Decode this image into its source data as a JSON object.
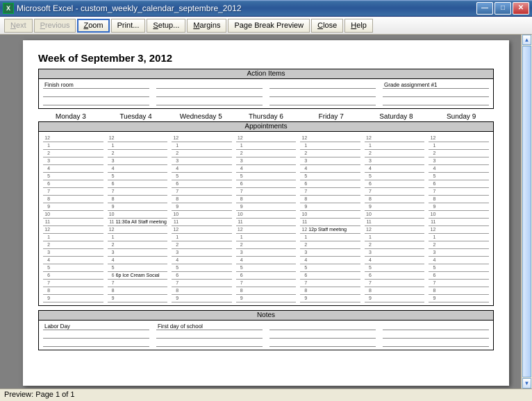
{
  "window": {
    "app_name": "Microsoft Excel",
    "doc_name": "custom_weekly_calendar_septembre_2012",
    "title_sep": " - "
  },
  "toolbar": {
    "next": "Next",
    "previous": "Previous",
    "zoom": "Zoom",
    "print": "Print...",
    "setup": "Setup...",
    "margins": "Margins",
    "page_break": "Page Break Preview",
    "close": "Close",
    "help": "Help"
  },
  "page": {
    "week_title": "Week of September 3, 2012",
    "action_items_header": "Action Items",
    "appointments_header": "Appointments",
    "notes_header": "Notes",
    "days": [
      "Monday 3",
      "Tuesday 4",
      "Wednesday 5",
      "Thursday 6",
      "Friday 7",
      "Saturday 8",
      "Sunday 9"
    ],
    "hours": [
      "12",
      "1",
      "2",
      "3",
      "4",
      "5",
      "6",
      "7",
      "8",
      "9",
      "10",
      "11",
      "12",
      "1",
      "2",
      "3",
      "4",
      "5",
      "6",
      "7",
      "8",
      "9"
    ],
    "action_items": {
      "rows": 3,
      "cols": 4,
      "items": [
        {
          "row": 0,
          "col": 0,
          "text": "Finish room"
        },
        {
          "row": 0,
          "col": 3,
          "text": "Grade assignment #1"
        }
      ]
    },
    "appointments": [
      {
        "day": 1,
        "hour_index": 11,
        "text": "11:30a All Staff meeting"
      },
      {
        "day": 1,
        "hour_index": 18,
        "text": "6p Ice Cream Social"
      },
      {
        "day": 4,
        "hour_index": 12,
        "text": "12p Staff meeting"
      }
    ],
    "notes": {
      "rows": 3,
      "cols": 4,
      "items": [
        {
          "row": 0,
          "col": 0,
          "text": "Labor Day"
        },
        {
          "row": 0,
          "col": 1,
          "text": "First day of school"
        }
      ]
    }
  },
  "status": {
    "text": "Preview: Page 1 of 1"
  }
}
